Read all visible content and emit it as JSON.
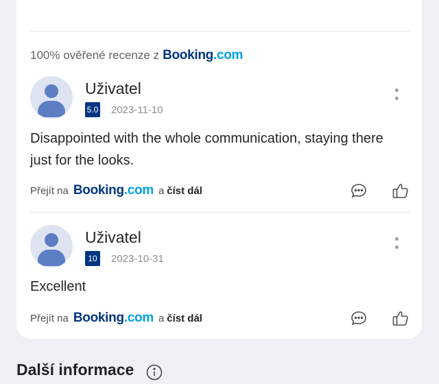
{
  "verified": {
    "prefix": "100% ověřené recenze z",
    "brand_a": "Booking",
    "brand_b": ".com"
  },
  "reviews": [
    {
      "user": "Uživatel",
      "score": "5.0",
      "date": "2023-11-10",
      "text": "Disappointed with the whole communication, staying there just for the looks.",
      "goto": "Přejít na",
      "brand_a": "Booking",
      "brand_b": ".com",
      "and": "a",
      "read_more": "číst dál"
    },
    {
      "user": "Uživatel",
      "score": "10",
      "date": "2023-10-31",
      "text": "Excellent",
      "goto": "Přejít na",
      "brand_a": "Booking",
      "brand_b": ".com",
      "and": "a",
      "read_more": "číst dál"
    }
  ],
  "more_info": {
    "title": "Další informace"
  },
  "colors": {
    "booking_dark": "#003580",
    "booking_light": "#009fe3",
    "avatar_bg": "#dde3f0",
    "avatar_fg": "#5c7fc4"
  },
  "icons": [
    "avatar-icon",
    "more-vertical-icon",
    "comment-icon",
    "thumbs-up-icon",
    "info-icon"
  ]
}
